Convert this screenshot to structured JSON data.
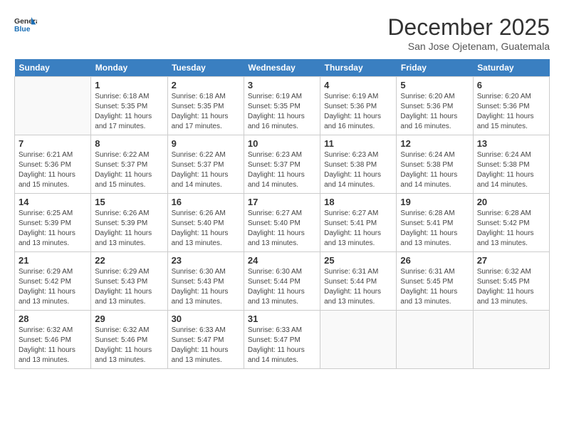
{
  "header": {
    "logo_line1": "General",
    "logo_line2": "Blue",
    "month": "December 2025",
    "location": "San Jose Ojetenam, Guatemala"
  },
  "days_of_week": [
    "Sunday",
    "Monday",
    "Tuesday",
    "Wednesday",
    "Thursday",
    "Friday",
    "Saturday"
  ],
  "weeks": [
    [
      {
        "day": "",
        "info": ""
      },
      {
        "day": "1",
        "info": "Sunrise: 6:18 AM\nSunset: 5:35 PM\nDaylight: 11 hours\nand 17 minutes."
      },
      {
        "day": "2",
        "info": "Sunrise: 6:18 AM\nSunset: 5:35 PM\nDaylight: 11 hours\nand 17 minutes."
      },
      {
        "day": "3",
        "info": "Sunrise: 6:19 AM\nSunset: 5:35 PM\nDaylight: 11 hours\nand 16 minutes."
      },
      {
        "day": "4",
        "info": "Sunrise: 6:19 AM\nSunset: 5:36 PM\nDaylight: 11 hours\nand 16 minutes."
      },
      {
        "day": "5",
        "info": "Sunrise: 6:20 AM\nSunset: 5:36 PM\nDaylight: 11 hours\nand 16 minutes."
      },
      {
        "day": "6",
        "info": "Sunrise: 6:20 AM\nSunset: 5:36 PM\nDaylight: 11 hours\nand 15 minutes."
      }
    ],
    [
      {
        "day": "7",
        "info": "Sunrise: 6:21 AM\nSunset: 5:36 PM\nDaylight: 11 hours\nand 15 minutes."
      },
      {
        "day": "8",
        "info": "Sunrise: 6:22 AM\nSunset: 5:37 PM\nDaylight: 11 hours\nand 15 minutes."
      },
      {
        "day": "9",
        "info": "Sunrise: 6:22 AM\nSunset: 5:37 PM\nDaylight: 11 hours\nand 14 minutes."
      },
      {
        "day": "10",
        "info": "Sunrise: 6:23 AM\nSunset: 5:37 PM\nDaylight: 11 hours\nand 14 minutes."
      },
      {
        "day": "11",
        "info": "Sunrise: 6:23 AM\nSunset: 5:38 PM\nDaylight: 11 hours\nand 14 minutes."
      },
      {
        "day": "12",
        "info": "Sunrise: 6:24 AM\nSunset: 5:38 PM\nDaylight: 11 hours\nand 14 minutes."
      },
      {
        "day": "13",
        "info": "Sunrise: 6:24 AM\nSunset: 5:38 PM\nDaylight: 11 hours\nand 14 minutes."
      }
    ],
    [
      {
        "day": "14",
        "info": "Sunrise: 6:25 AM\nSunset: 5:39 PM\nDaylight: 11 hours\nand 13 minutes."
      },
      {
        "day": "15",
        "info": "Sunrise: 6:26 AM\nSunset: 5:39 PM\nDaylight: 11 hours\nand 13 minutes."
      },
      {
        "day": "16",
        "info": "Sunrise: 6:26 AM\nSunset: 5:40 PM\nDaylight: 11 hours\nand 13 minutes."
      },
      {
        "day": "17",
        "info": "Sunrise: 6:27 AM\nSunset: 5:40 PM\nDaylight: 11 hours\nand 13 minutes."
      },
      {
        "day": "18",
        "info": "Sunrise: 6:27 AM\nSunset: 5:41 PM\nDaylight: 11 hours\nand 13 minutes."
      },
      {
        "day": "19",
        "info": "Sunrise: 6:28 AM\nSunset: 5:41 PM\nDaylight: 11 hours\nand 13 minutes."
      },
      {
        "day": "20",
        "info": "Sunrise: 6:28 AM\nSunset: 5:42 PM\nDaylight: 11 hours\nand 13 minutes."
      }
    ],
    [
      {
        "day": "21",
        "info": "Sunrise: 6:29 AM\nSunset: 5:42 PM\nDaylight: 11 hours\nand 13 minutes."
      },
      {
        "day": "22",
        "info": "Sunrise: 6:29 AM\nSunset: 5:43 PM\nDaylight: 11 hours\nand 13 minutes."
      },
      {
        "day": "23",
        "info": "Sunrise: 6:30 AM\nSunset: 5:43 PM\nDaylight: 11 hours\nand 13 minutes."
      },
      {
        "day": "24",
        "info": "Sunrise: 6:30 AM\nSunset: 5:44 PM\nDaylight: 11 hours\nand 13 minutes."
      },
      {
        "day": "25",
        "info": "Sunrise: 6:31 AM\nSunset: 5:44 PM\nDaylight: 11 hours\nand 13 minutes."
      },
      {
        "day": "26",
        "info": "Sunrise: 6:31 AM\nSunset: 5:45 PM\nDaylight: 11 hours\nand 13 minutes."
      },
      {
        "day": "27",
        "info": "Sunrise: 6:32 AM\nSunset: 5:45 PM\nDaylight: 11 hours\nand 13 minutes."
      }
    ],
    [
      {
        "day": "28",
        "info": "Sunrise: 6:32 AM\nSunset: 5:46 PM\nDaylight: 11 hours\nand 13 minutes."
      },
      {
        "day": "29",
        "info": "Sunrise: 6:32 AM\nSunset: 5:46 PM\nDaylight: 11 hours\nand 13 minutes."
      },
      {
        "day": "30",
        "info": "Sunrise: 6:33 AM\nSunset: 5:47 PM\nDaylight: 11 hours\nand 13 minutes."
      },
      {
        "day": "31",
        "info": "Sunrise: 6:33 AM\nSunset: 5:47 PM\nDaylight: 11 hours\nand 14 minutes."
      },
      {
        "day": "",
        "info": ""
      },
      {
        "day": "",
        "info": ""
      },
      {
        "day": "",
        "info": ""
      }
    ]
  ]
}
